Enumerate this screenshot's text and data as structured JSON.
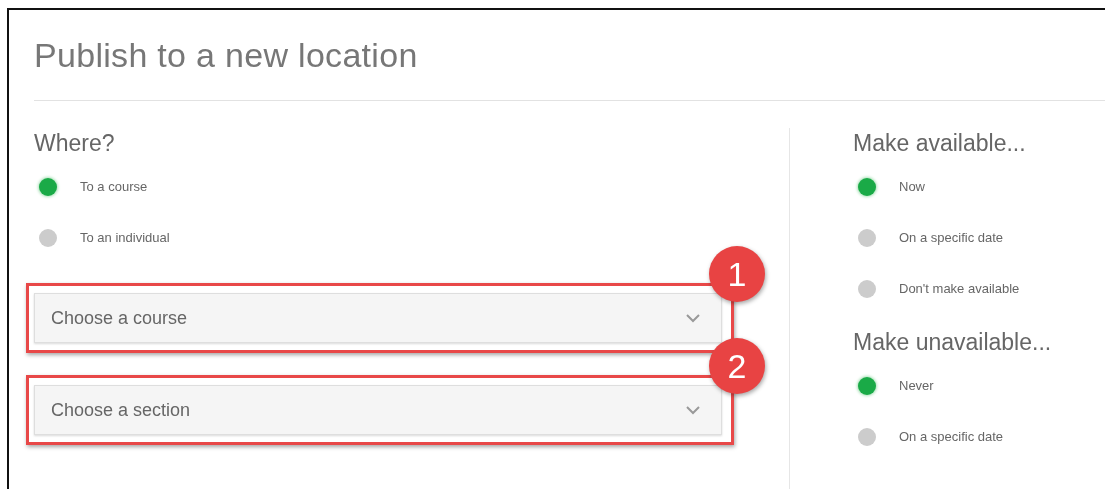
{
  "title": "Publish to a new location",
  "where": {
    "heading": "Where?",
    "options": [
      {
        "label": "To a course",
        "selected": true
      },
      {
        "label": "To an individual",
        "selected": false
      }
    ]
  },
  "dropdowns": [
    {
      "placeholder": "Choose a course",
      "callout": "1"
    },
    {
      "placeholder": "Choose a section",
      "callout": "2"
    }
  ],
  "make_available": {
    "heading": "Make available...",
    "options": [
      {
        "label": "Now",
        "selected": true
      },
      {
        "label": "On a specific date",
        "selected": false
      },
      {
        "label": "Don't make available",
        "selected": false
      }
    ]
  },
  "make_unavailable": {
    "heading": "Make unavailable...",
    "options": [
      {
        "label": "Never",
        "selected": true
      },
      {
        "label": "On a specific date",
        "selected": false
      }
    ]
  }
}
